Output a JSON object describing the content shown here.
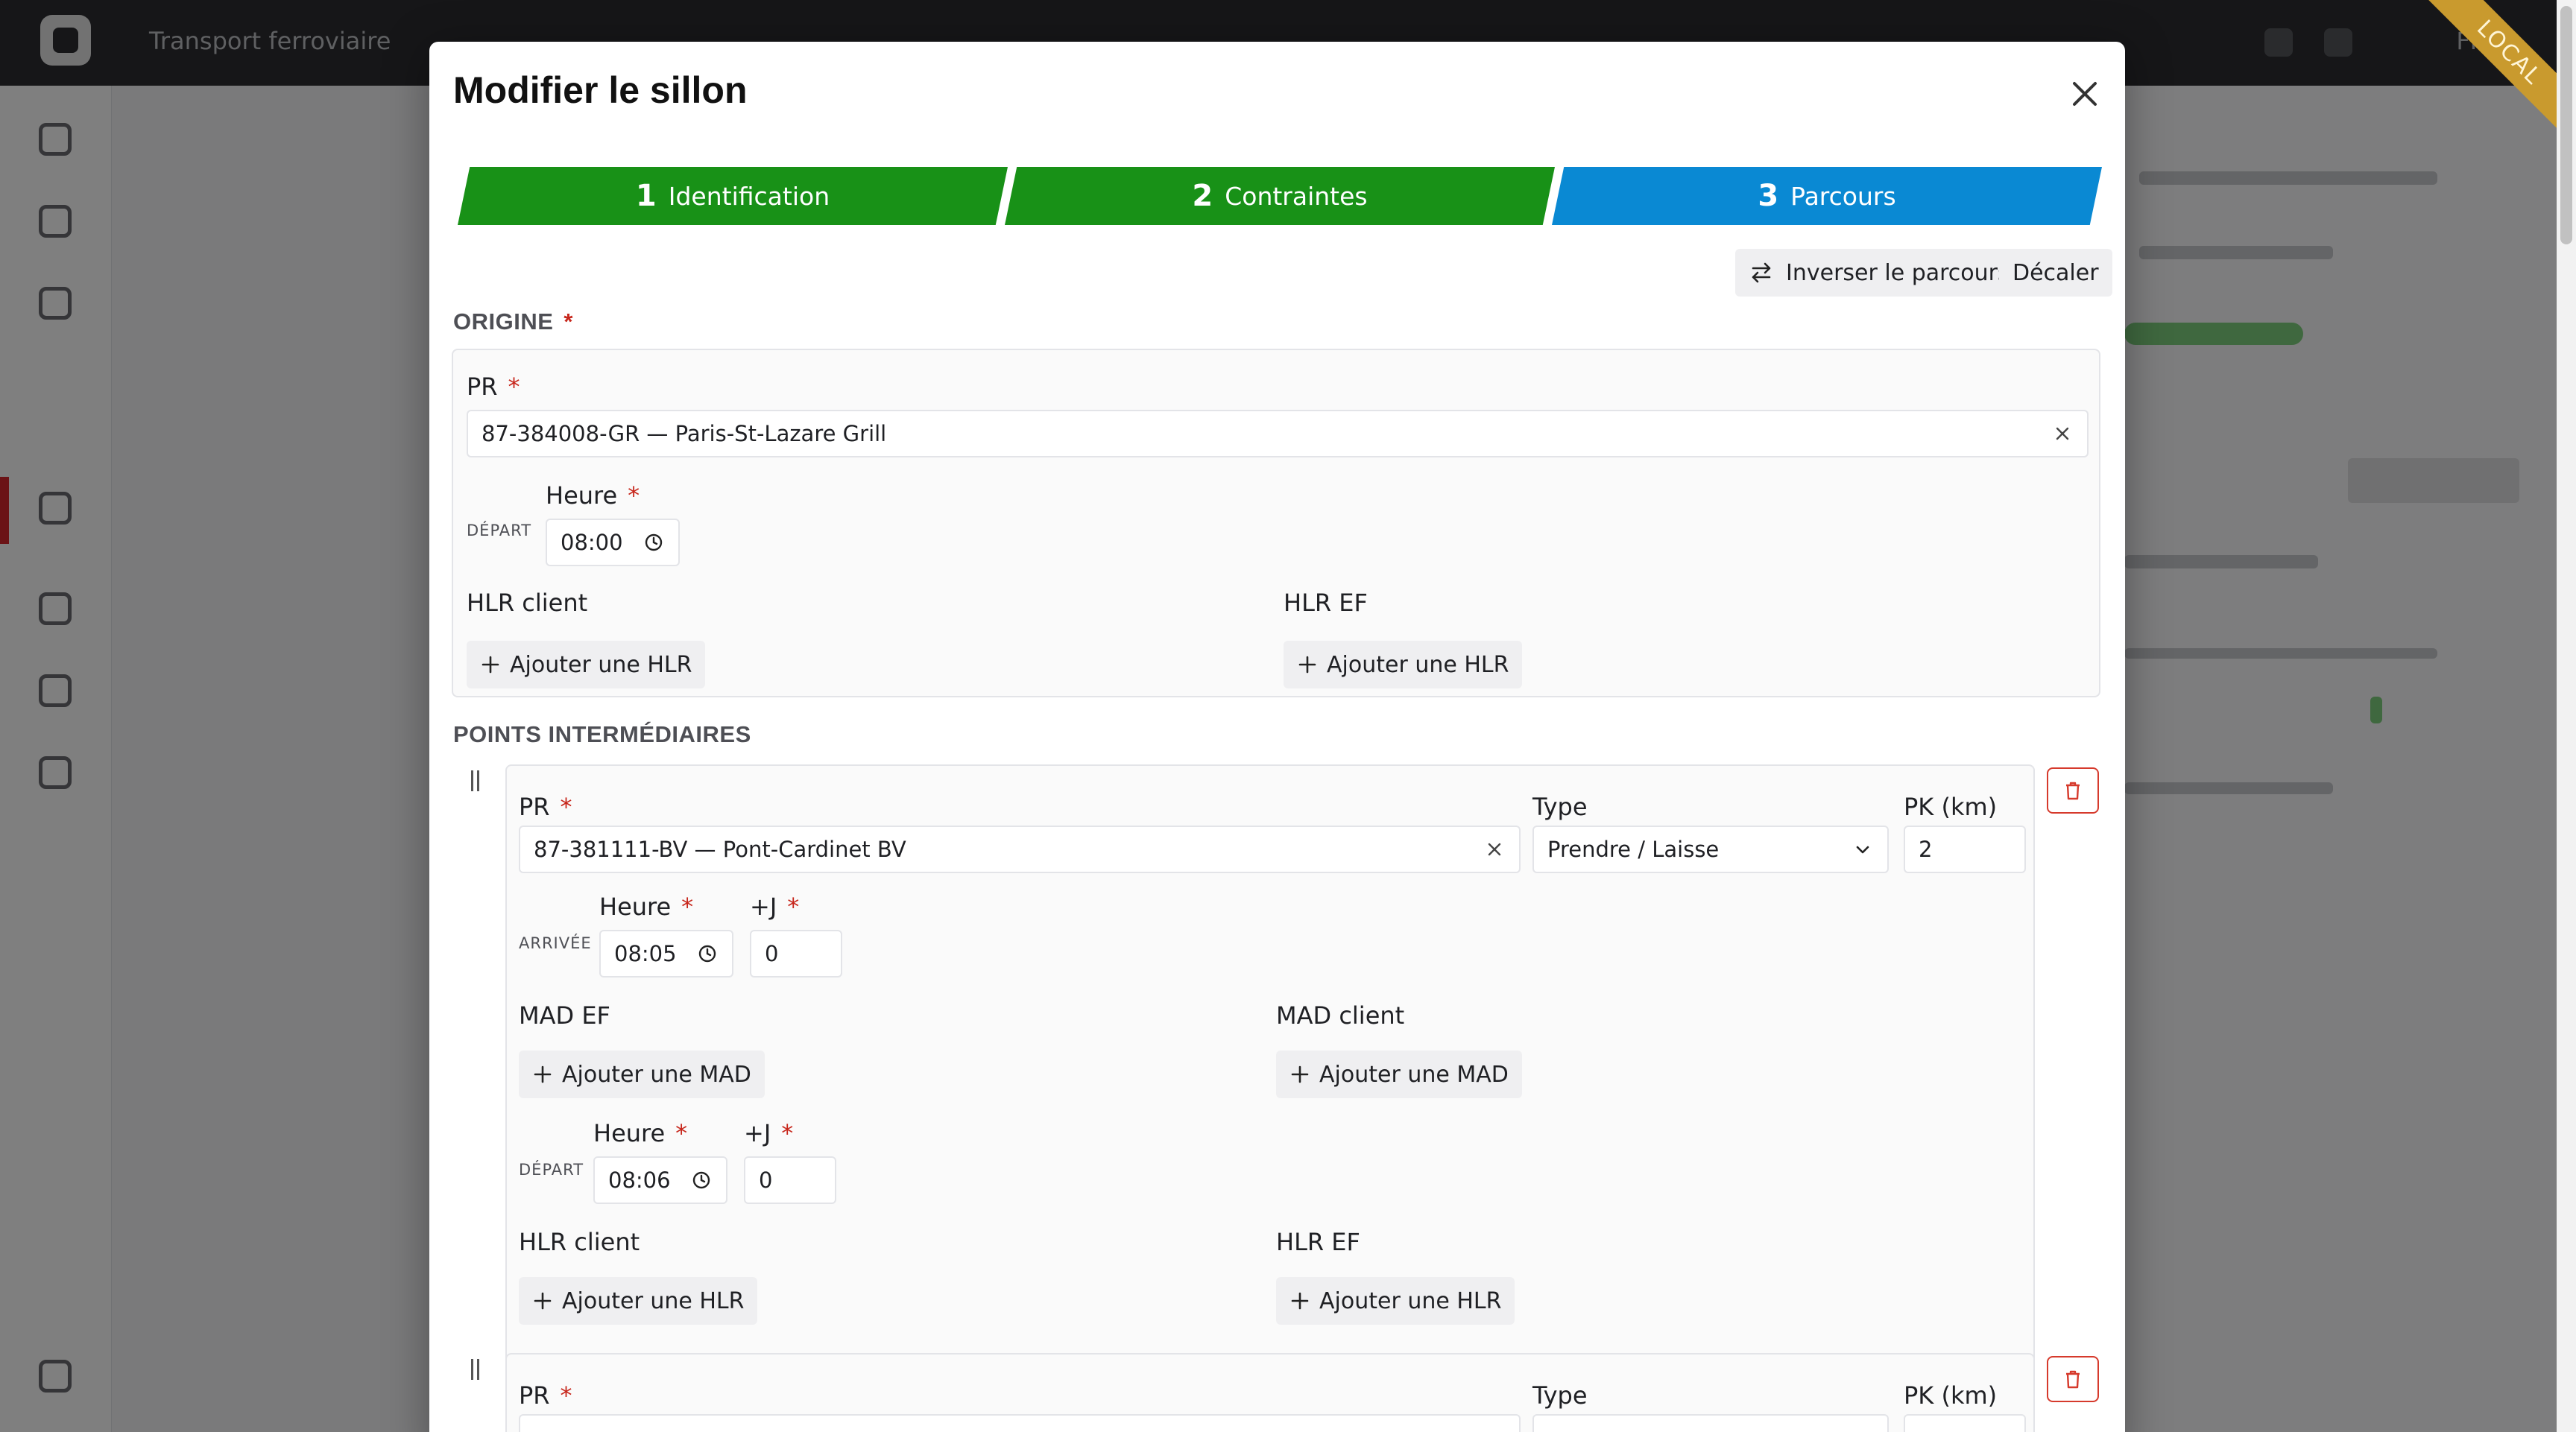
{
  "background": {
    "app_title": "Transport ferroviaire",
    "user_label": "FR",
    "env_badge": "LOCAL"
  },
  "modal": {
    "title": "Modifier le sillon",
    "steps": [
      {
        "num": "1",
        "label": "Identification",
        "state": "done"
      },
      {
        "num": "2",
        "label": "Contraintes",
        "state": "done"
      },
      {
        "num": "3",
        "label": "Parcours",
        "state": "active"
      }
    ],
    "actions": {
      "invert_label": "Inverser le parcours",
      "shift_label": "Décaler"
    },
    "origin": {
      "section_title": "ORIGINE",
      "pr_label": "PR",
      "pr_value": "87-384008-GR — Paris-St-Lazare Grill",
      "departure_label": "DÉPART",
      "time_label": "Heure",
      "time_value": "08:00",
      "hlr_client_label": "HLR client",
      "hlr_ef_label": "HLR EF",
      "add_hlr_label": "Ajouter une HLR"
    },
    "intermediate": {
      "section_title": "POINTS INTERMÉDIAIRES",
      "points": [
        {
          "pr_label": "PR",
          "pr_value": "87-381111-BV — Pont-Cardinet BV",
          "type_label": "Type",
          "type_value": "Prendre / Laisse",
          "pk_label": "PK (km)",
          "pk_value": "2",
          "arrival_label": "ARRIVÉE",
          "arrival_time_label": "Heure",
          "arrival_time": "08:05",
          "arrival_day_label": "+J",
          "arrival_day": "0",
          "mad_ef_label": "MAD EF",
          "mad_client_label": "MAD client",
          "add_mad_label": "Ajouter une MAD",
          "departure_label": "DÉPART",
          "departure_time_label": "Heure",
          "departure_time": "08:06",
          "departure_day_label": "+J",
          "departure_day": "0",
          "hlr_client_label": "HLR client",
          "hlr_ef_label": "HLR EF",
          "add_hlr_label": "Ajouter une HLR"
        },
        {
          "pr_label": "PR",
          "type_label": "Type",
          "pk_label": "PK (km)"
        }
      ]
    }
  },
  "colors": {
    "step_done": "#189117",
    "step_active": "#0a89d3",
    "required": "#c7261b",
    "danger": "#d63a2c"
  }
}
